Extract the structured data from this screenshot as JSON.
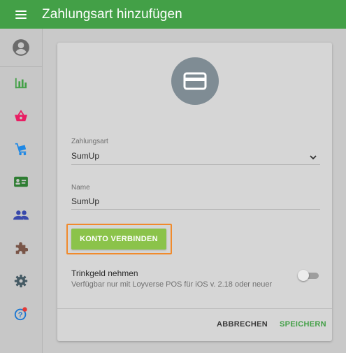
{
  "header": {
    "title": "Zahlungsart hinzufügen",
    "menu_icon": "hamburger-menu-icon",
    "bar_color": "#43a047"
  },
  "sidebar": {
    "items": [
      {
        "icon": "account-icon",
        "color": "#6b6b6b"
      },
      {
        "icon": "bar-chart-icon",
        "color": "#43a047"
      },
      {
        "icon": "shopping-basket-icon",
        "color": "#e91e63"
      },
      {
        "icon": "cart-icon",
        "color": "#1e88e5"
      },
      {
        "icon": "id-card-icon",
        "color": "#2e7d32"
      },
      {
        "icon": "people-icon",
        "color": "#3949ab"
      },
      {
        "icon": "puzzle-icon",
        "color": "#795548"
      },
      {
        "icon": "gear-icon",
        "color": "#455a64"
      },
      {
        "icon": "help-icon",
        "color": "#1976d2",
        "badge_color": "#e53935"
      }
    ]
  },
  "form": {
    "payment_icon": "credit-card-icon",
    "type_label": "Zahlungsart",
    "type_value": "SumUp",
    "name_label": "Name",
    "name_value": "SumUp",
    "connect_button": "KONTO VERBINDEN",
    "tip_title": "Trinkgeld nehmen",
    "tip_subtitle": "Verfügbar nur mit Loyverse POS für iOS v. 2.18 oder neuer",
    "tip_enabled": false
  },
  "actions": {
    "cancel": "ABBRECHEN",
    "save": "SPEICHERN",
    "accent": "#43a047"
  }
}
